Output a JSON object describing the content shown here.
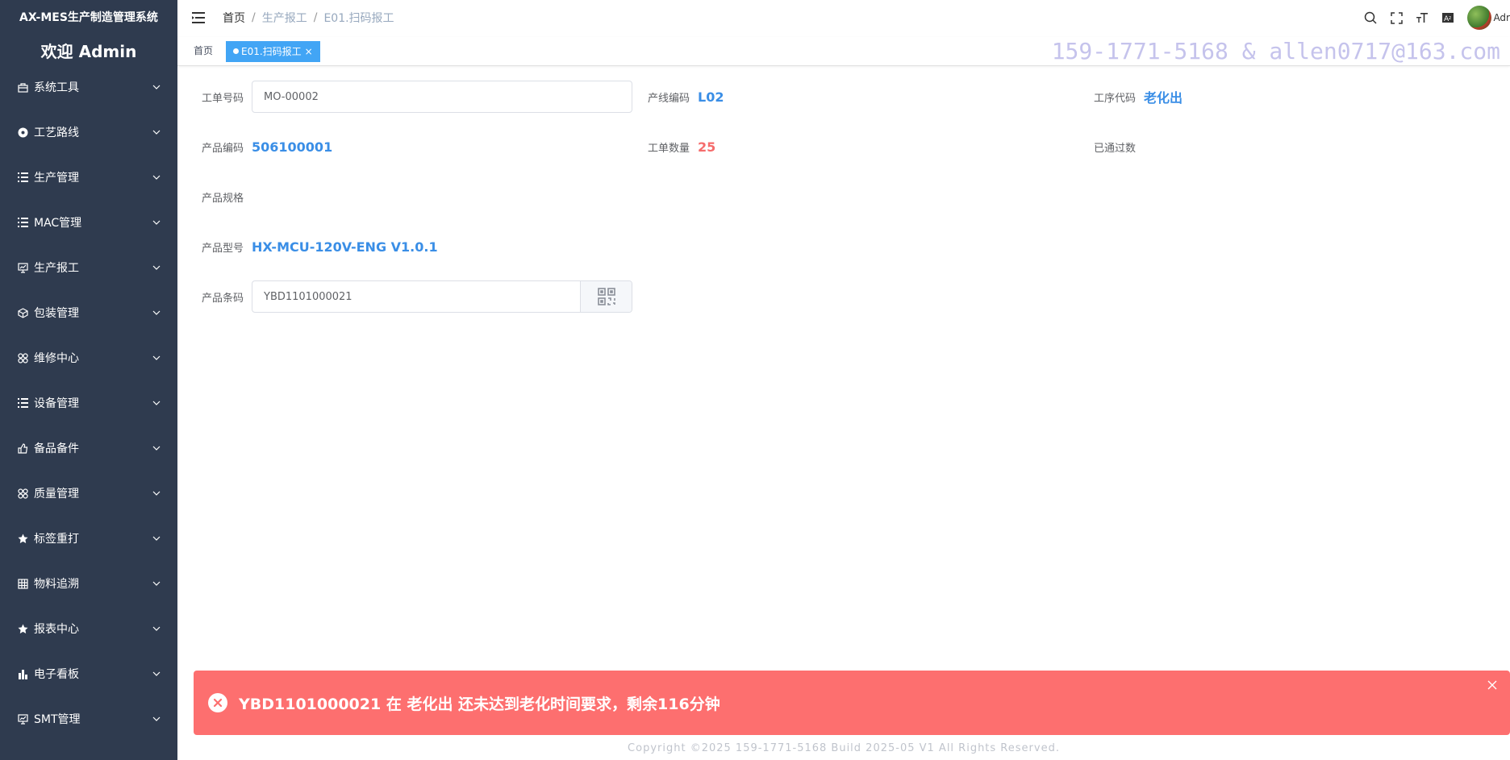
{
  "sidebar": {
    "brand": "AX-MES生产制造管理系统",
    "welcome": "欢迎 Admin",
    "items": [
      {
        "label": "系统工具",
        "icon": "toolbox-icon"
      },
      {
        "label": "工艺路线",
        "icon": "route-icon"
      },
      {
        "label": "生产管理",
        "icon": "list-icon"
      },
      {
        "label": "MAC管理",
        "icon": "list-icon"
      },
      {
        "label": "生产报工",
        "icon": "monitor-chart-icon"
      },
      {
        "label": "包装管理",
        "icon": "box-icon"
      },
      {
        "label": "维修中心",
        "icon": "grid-icon"
      },
      {
        "label": "设备管理",
        "icon": "list-icon"
      },
      {
        "label": "备品备件",
        "icon": "thumb-icon"
      },
      {
        "label": "质量管理",
        "icon": "grid-icon"
      },
      {
        "label": "标签重打",
        "icon": "star-icon"
      },
      {
        "label": "物料追溯",
        "icon": "table-icon"
      },
      {
        "label": "报表中心",
        "icon": "star-icon"
      },
      {
        "label": "电子看板",
        "icon": "bar-chart-icon"
      },
      {
        "label": "SMT管理",
        "icon": "monitor-chart-icon"
      }
    ]
  },
  "header": {
    "breadcrumb": [
      "首页",
      "生产报工",
      "E01.扫码报工"
    ],
    "user": "Adr"
  },
  "tabs": {
    "home": "首页",
    "active": "E01.扫码报工"
  },
  "watermark": "159-1771-5168 & allen0717@163.com",
  "form": {
    "work_order": {
      "label": "工单号码",
      "value": "MO-00002"
    },
    "line_code": {
      "label": "产线编码",
      "value": "L02"
    },
    "process_code": {
      "label": "工序代码",
      "value": "老化出"
    },
    "product_code": {
      "label": "产品编码",
      "value": "506100001"
    },
    "order_qty": {
      "label": "工单数量",
      "value": "25"
    },
    "passed_qty": {
      "label": "已通过数",
      "value": ""
    },
    "product_spec": {
      "label": "产品规格",
      "value": ""
    },
    "product_model": {
      "label": "产品型号",
      "value": "HX-MCU-120V-ENG V1.0.1"
    },
    "barcode": {
      "label": "产品条码",
      "value": "YBD1101000021"
    }
  },
  "alert": {
    "message": "YBD1101000021 在 老化出 还未达到老化时间要求，剩余116分钟",
    "color": "#fd6f6f"
  },
  "footer": "Copyright ©2025 159-1771-5168 Build 2025-05 V1 All Rights Reserved."
}
